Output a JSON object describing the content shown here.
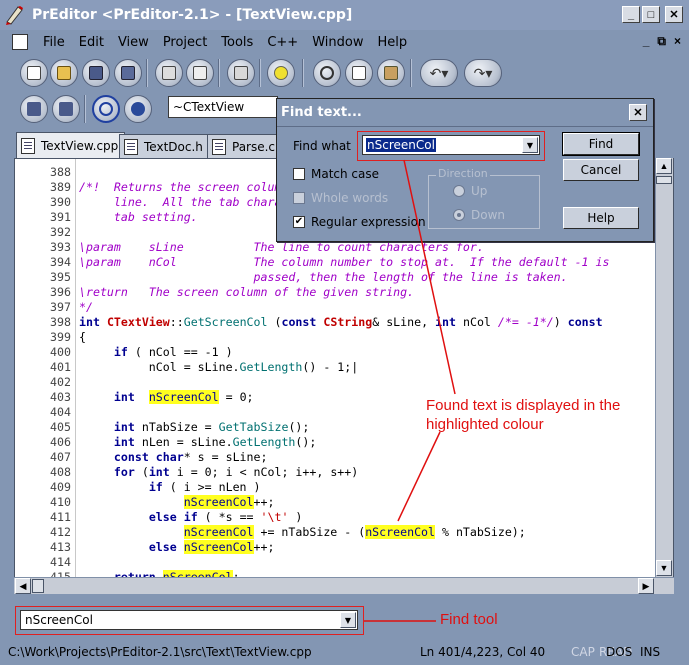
{
  "window": {
    "title": "PrEditor <PrEditor-2.1> - [TextView.cpp]",
    "min_glyph": "_",
    "max_glyph": "□",
    "close_glyph": "✕"
  },
  "menu": {
    "items": [
      {
        "label": "File"
      },
      {
        "label": "Edit"
      },
      {
        "label": "View"
      },
      {
        "label": "Project"
      },
      {
        "label": "Tools"
      },
      {
        "label": "C++"
      },
      {
        "label": "Window"
      },
      {
        "label": "Help"
      }
    ],
    "mdi_min": "_",
    "mdi_restore": "⧉",
    "mdi_close": "×"
  },
  "toolbar": {
    "function_combo": "~CTextView"
  },
  "tabs": [
    {
      "label": "TextView.cpp",
      "active": true
    },
    {
      "label": "TextDoc.h",
      "active": false
    },
    {
      "label": "Parse.cpp",
      "active": false
    }
  ],
  "editor": {
    "lines": [
      {
        "n": "388",
        "html": ""
      },
      {
        "n": "389",
        "html": "<span class='cm'>/*!  Returns the screen column position of a character in the given</span>"
      },
      {
        "n": "390",
        "html": "<span class='cm'>     line.  All the tab characters are expanded according to the current</span>"
      },
      {
        "n": "391",
        "html": "<span class='cm'>     tab setting.</span>"
      },
      {
        "n": "392",
        "html": ""
      },
      {
        "n": "393",
        "html": "<span class='cm'>\\param    sLine          The line to count characters for.</span>"
      },
      {
        "n": "394",
        "html": "<span class='cm'>\\param    nCol           The column number to stop at.  If the default -1 is</span>"
      },
      {
        "n": "395",
        "html": "<span class='cm'>                         passed, then the length of the line is taken.</span>"
      },
      {
        "n": "396",
        "html": "<span class='cm'>\\return   The screen column of the given string.</span>"
      },
      {
        "n": "397",
        "html": "<span class='cm'>*/</span>"
      },
      {
        "n": "398",
        "html": "<span class='kw'>int</span> <span class='ty'>CTextView</span>::<span class='fn'>GetScreenCol</span> (<span class='kw'>const</span> <span class='ty'>CString</span>&amp; sLine, <span class='kw'>int</span> nCol <span class='cm'>/*= -1*/</span>) <span class='kw'>const</span>"
      },
      {
        "n": "399",
        "html": "{"
      },
      {
        "n": "400",
        "html": "     <span class='kw'>if</span> ( nCol == -1 )"
      },
      {
        "n": "401",
        "html": "          nCol = sLine.<span class='fn'>GetLength</span>() - 1;|"
      },
      {
        "n": "402",
        "html": ""
      },
      {
        "n": "403",
        "html": "     <span class='kw'>int</span>  <span class='hl'>nScreenCol</span> = 0;"
      },
      {
        "n": "404",
        "html": ""
      },
      {
        "n": "405",
        "html": "     <span class='kw'>int</span> nTabSize = <span class='fn'>GetTabSize</span>();"
      },
      {
        "n": "406",
        "html": "     <span class='kw'>int</span> nLen = sLine.<span class='fn'>GetLength</span>();"
      },
      {
        "n": "407",
        "html": "     <span class='kw'>const</span> <span class='kw'>char</span>* s = sLine;"
      },
      {
        "n": "408",
        "html": "     <span class='kw'>for</span> (<span class='kw'>int</span> i = 0; i &lt; nCol; i++, s++)"
      },
      {
        "n": "409",
        "html": "          <span class='kw'>if</span> ( i &gt;= nLen )"
      },
      {
        "n": "410",
        "html": "               <span class='hl'>nScreenCol</span>++;"
      },
      {
        "n": "411",
        "html": "          <span class='kw'>else if</span> ( *s == <span class='str'>'\\t'</span> )"
      },
      {
        "n": "412",
        "html": "               <span class='hl'>nScreenCol</span> += nTabSize - (<span class='hl'>nScreenCol</span> % nTabSize);"
      },
      {
        "n": "413",
        "html": "          <span class='kw'>else</span> <span class='hl'>nScreenCol</span>++;"
      },
      {
        "n": "414",
        "html": ""
      },
      {
        "n": "415",
        "html": "     <span class='kw'>return</span> <span class='hl'>nScreenCol</span>;"
      }
    ]
  },
  "find_tool": {
    "value": "nScreenCol"
  },
  "status": {
    "path": "C:\\Work\\Projects\\PrEditor-2.1\\src\\Text\\TextView.cpp",
    "position": "Ln 401/4,223, Col 40",
    "cap": "CAP",
    "read": "READ",
    "dos": "DOS",
    "ins": "INS"
  },
  "find_dialog": {
    "title": "Find text...",
    "find_what_label": "Find what",
    "find_what_value": "nScreenCol",
    "match_case": "Match case",
    "whole_words": "Whole words",
    "regex": "Regular expression",
    "direction": "Direction",
    "up": "Up",
    "down": "Down",
    "find_btn": "Find",
    "cancel_btn": "Cancel",
    "help_btn": "Help",
    "regex_checked": true
  },
  "annotations": {
    "found_text": "Found text is displayed in the highlighted colour",
    "find_tool": "Find tool"
  },
  "colors": {
    "chrome": "#8396b3",
    "highlight": "#ffff20",
    "annotation": "#e01010",
    "comment": "#a000c8"
  }
}
